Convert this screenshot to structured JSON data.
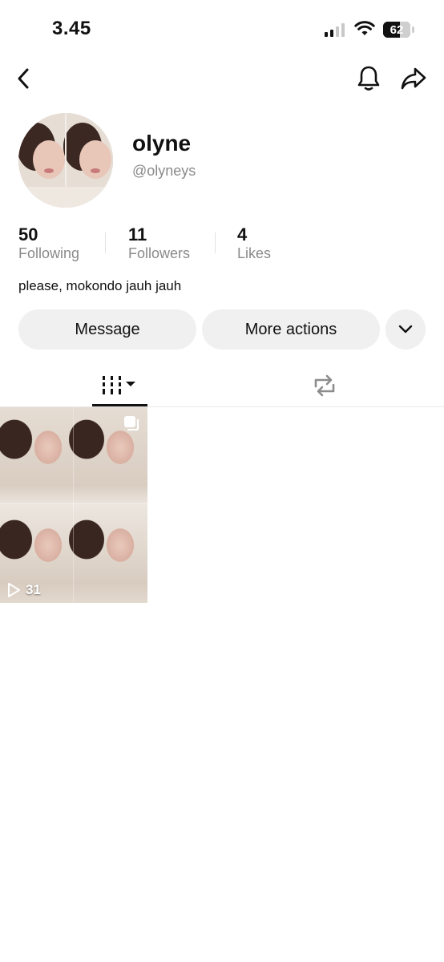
{
  "status_bar": {
    "time": "3.45",
    "battery_level": "62"
  },
  "nav": {
    "back_icon": "chevron-left-icon",
    "bell_icon": "bell-icon",
    "share_icon": "share-arrow-icon"
  },
  "profile": {
    "name": "olyne",
    "handle": "@olyneys",
    "bio": "please, mokondo jauh jauh"
  },
  "stats": [
    {
      "value": "50",
      "label": "Following"
    },
    {
      "value": "11",
      "label": "Followers"
    },
    {
      "value": "4",
      "label": "Likes"
    }
  ],
  "actions": {
    "message_label": "Message",
    "more_actions_label": "More actions"
  },
  "tabs": [
    {
      "icon": "videos-grid-icon",
      "selected": true
    },
    {
      "icon": "repost-icon",
      "selected": false
    }
  ],
  "videos": [
    {
      "views": "31",
      "multi_photo": true
    }
  ]
}
